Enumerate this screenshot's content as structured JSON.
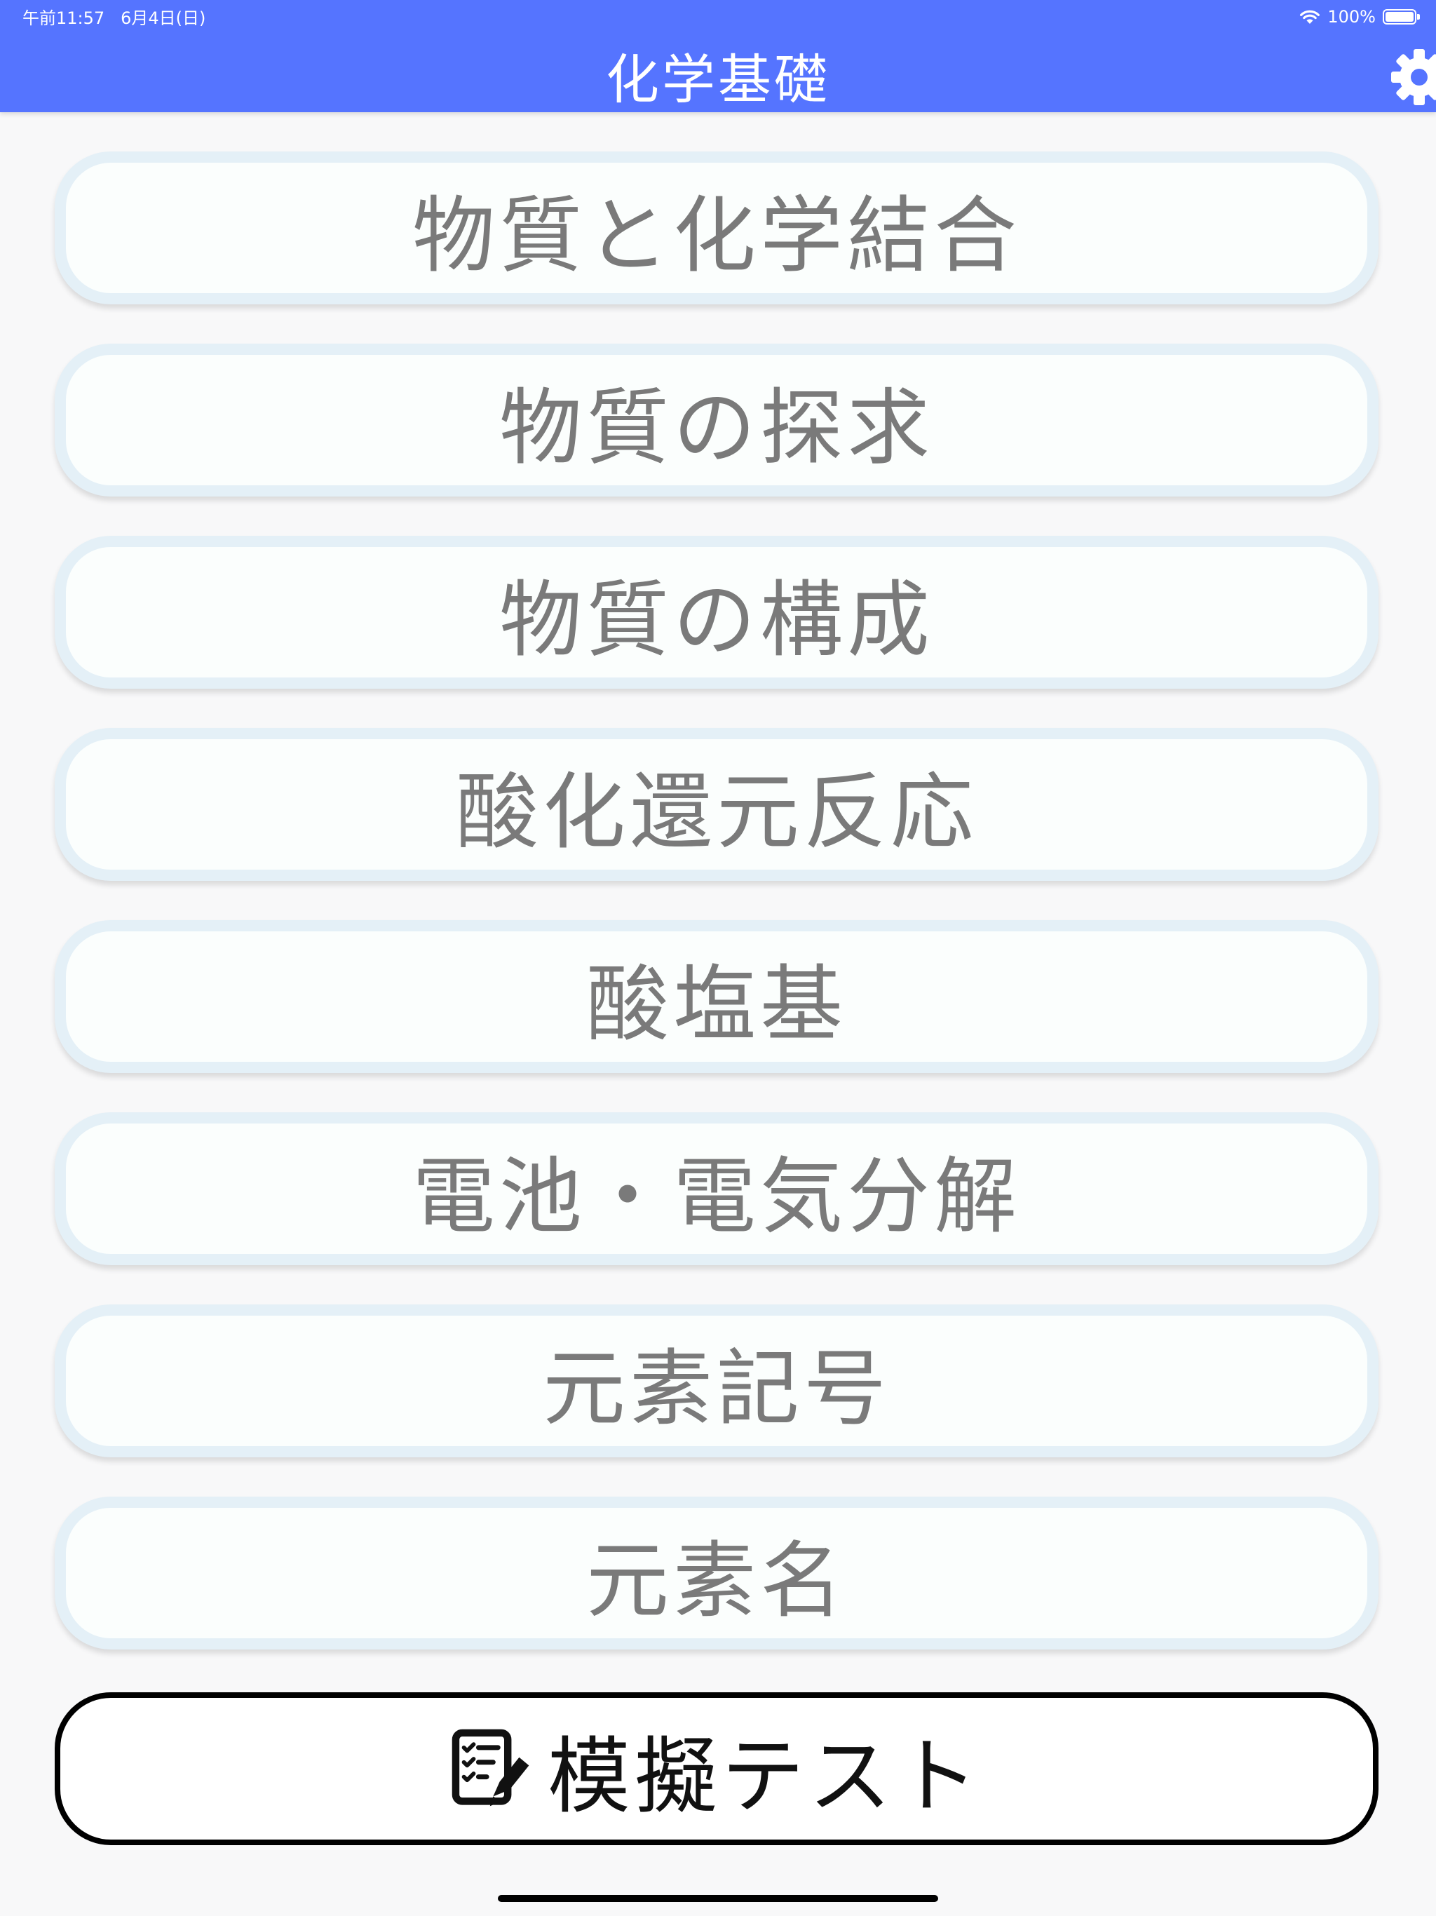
{
  "status_bar": {
    "time": "午前11:57",
    "date": "6月4日(日)",
    "battery": "100%",
    "battery_level": 1.0
  },
  "header": {
    "title": "化学基礎",
    "settings_icon": "gear-icon"
  },
  "menu": {
    "items": [
      {
        "label": "物質と化学結合"
      },
      {
        "label": "物質の探求"
      },
      {
        "label": "物質の構成"
      },
      {
        "label": "酸化還元反応"
      },
      {
        "label": "酸塩基"
      },
      {
        "label": "電池・電気分解"
      },
      {
        "label": "元素記号"
      },
      {
        "label": "元素名"
      }
    ]
  },
  "mock_test": {
    "label": "模擬テスト",
    "icon": "checklist-pencil-icon"
  },
  "colors": {
    "header": "#5574ff",
    "button_border": "#e4f0f7",
    "button_text": "#7a7a7a",
    "mock_border": "#000000"
  }
}
